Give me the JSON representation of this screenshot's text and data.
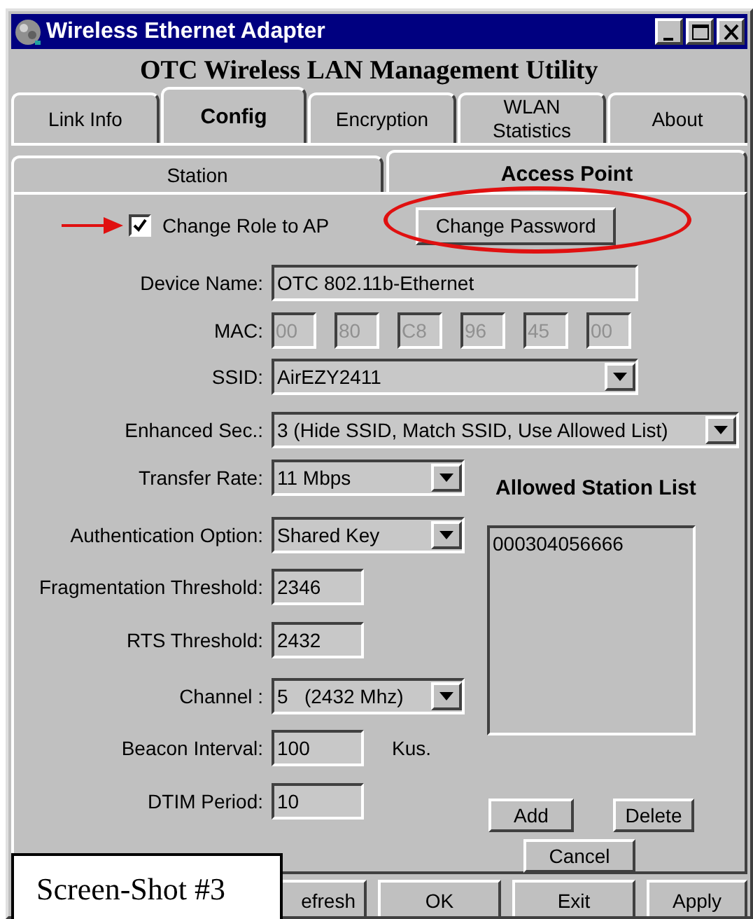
{
  "window": {
    "title": "Wireless Ethernet Adapter"
  },
  "header": "OTC Wireless LAN Management Utility",
  "tabs": [
    {
      "label": "Link Info",
      "selected": false
    },
    {
      "label": "Config",
      "selected": true
    },
    {
      "label": "Encryption",
      "selected": false
    },
    {
      "label": "WLAN Statistics",
      "selected": false
    },
    {
      "label": "About",
      "selected": false
    }
  ],
  "subtabs": [
    {
      "label": "Station",
      "selected": false
    },
    {
      "label": "Access Point",
      "selected": true
    }
  ],
  "change_role": {
    "label": "Change Role to AP",
    "checked": true
  },
  "change_password_button": "Change Password",
  "top_fields": [
    {
      "kind": "text",
      "label": "Device Name:",
      "value": "OTC 802.11b-Ethernet"
    },
    {
      "kind": "mac",
      "label": "MAC:",
      "disabled": true,
      "octets": [
        "00",
        "80",
        "C8",
        "96",
        "45",
        "00"
      ]
    },
    {
      "kind": "dropdown",
      "label": "SSID:",
      "value": "AirEZY2411"
    },
    {
      "kind": "dropdown",
      "label": "Enhanced Sec.:",
      "value": "3 (Hide SSID, Match SSID, Use Allowed List)"
    }
  ],
  "fields": [
    {
      "kind": "dropdown",
      "label": "Transfer Rate:",
      "value": "11 Mbps"
    },
    {
      "kind": "dropdown",
      "label": "Authentication Option:",
      "value": "Shared Key"
    },
    {
      "kind": "number",
      "label": "Fragmentation Threshold:",
      "value": "2346"
    },
    {
      "kind": "number",
      "label": "RTS Threshold:",
      "value": "2432"
    },
    {
      "kind": "dropdown",
      "label": "Channel :",
      "value": "5   (2432 Mhz)"
    },
    {
      "kind": "number",
      "label": "Beacon Interval:",
      "value": "100",
      "unit": "Kus."
    },
    {
      "kind": "number",
      "label": "DTIM Period:",
      "value": "10"
    }
  ],
  "allowed_list": {
    "title": "Allowed Station List",
    "items": [
      "000304056666"
    ]
  },
  "list_buttons": [
    "Add",
    "Delete",
    "Cancel"
  ],
  "footer_buttons": [
    "efresh",
    "OK",
    "Exit",
    "Apply"
  ],
  "caption": "Screen-Shot #3"
}
